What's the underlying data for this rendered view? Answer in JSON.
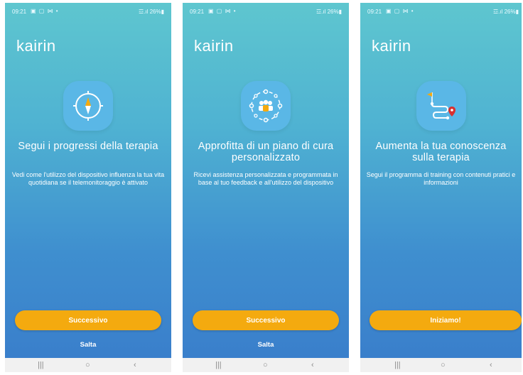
{
  "statusbar": {
    "time": "09:21",
    "left_icons": "▣ ▢ ⋈ •",
    "right": "☲.ıl 26%▮"
  },
  "brand": {
    "logo_text": "kairin"
  },
  "screens": [
    {
      "icon": "compass-icon",
      "headline": "Segui i progressi della terapia",
      "body": "Vedi come l'utilizzo del dispositivo influenza la tua vita quotidiana se il telemonitoraggio è attivato",
      "primary_button": "Successivo",
      "skip": "Salta"
    },
    {
      "icon": "care-team-icon",
      "headline": "Approfitta di un piano di cura personalizzato",
      "body": "Ricevi assistenza personalizzata e programmata in base al tuo feedback e all'utilizzo del dispositivo",
      "primary_button": "Successivo",
      "skip": "Salta"
    },
    {
      "icon": "route-map-icon",
      "headline": "Aumenta la tua conoscenza sulla terapia",
      "body": "Segui il programma di training con contenuti pratici e informazioni",
      "primary_button": "Iniziamo!"
    }
  ],
  "navbar": {
    "recents": "|||",
    "home": "○",
    "back": "‹"
  },
  "colors": {
    "accent": "#f4aa0f",
    "tile": "#5ab7e6",
    "gradient_top": "#5ec6cf",
    "gradient_bottom": "#3a7fcb"
  }
}
